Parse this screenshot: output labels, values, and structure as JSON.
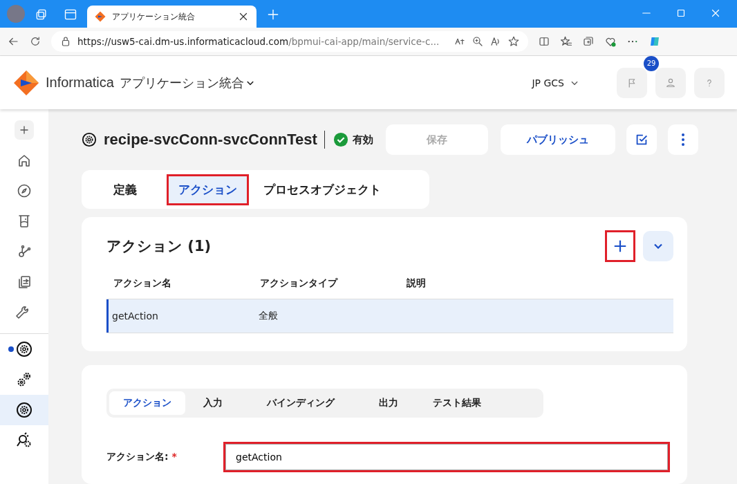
{
  "browser": {
    "tab_title": "アプリケーション統合",
    "url_host": "https://usw5-cai.dm-us.informaticacloud.com",
    "url_path": "/bpmui-cai-app/main/service-c..."
  },
  "app_header": {
    "brand": "Informatica",
    "product": "アプリケーション統合",
    "org": "JP GCS",
    "notification_count": "29"
  },
  "sidebar": {
    "items": [
      {
        "kind": "add",
        "selected": false,
        "marked": false
      },
      {
        "kind": "home",
        "selected": false,
        "marked": false
      },
      {
        "kind": "compass",
        "selected": false,
        "marked": false
      },
      {
        "kind": "beaker",
        "selected": false,
        "marked": false
      },
      {
        "kind": "network",
        "selected": false,
        "marked": false
      },
      {
        "kind": "transfer",
        "selected": false,
        "marked": false
      },
      {
        "kind": "wrench",
        "selected": false,
        "marked": false
      },
      {
        "kind": "gear",
        "selected": false,
        "marked": true
      },
      {
        "kind": "gears",
        "selected": false,
        "marked": false
      },
      {
        "kind": "gear",
        "selected": true,
        "marked": false
      },
      {
        "kind": "plug",
        "selected": false,
        "marked": false
      }
    ]
  },
  "page": {
    "title": "recipe-svcConn-svcConnTest",
    "status": "有効",
    "buttons": [
      {
        "label": "保存",
        "disabled": true
      },
      {
        "label": "パブリッシュ",
        "disabled": false
      }
    ]
  },
  "tabs": [
    {
      "label": "定義",
      "selected": false,
      "highlighted": false
    },
    {
      "label": "アクション",
      "selected": true,
      "highlighted": true
    },
    {
      "label": "プロセスオブジェクト",
      "selected": false,
      "highlighted": false
    }
  ],
  "actions_panel": {
    "title": "アクション (1)",
    "add_highlighted": true,
    "columns": [
      "アクション名",
      "アクションタイプ",
      "説明"
    ],
    "rows": [
      {
        "cells": [
          "getAction",
          "全般",
          ""
        ],
        "selected": true
      }
    ]
  },
  "detail_tabs": [
    {
      "label": "アクション",
      "selected": true
    },
    {
      "label": "入力",
      "selected": false
    },
    {
      "label": "バインディング",
      "selected": false
    },
    {
      "label": "出力",
      "selected": false
    },
    {
      "label": "テスト結果",
      "selected": false
    }
  ],
  "form": {
    "label": "アクション名:",
    "required_mark": "*",
    "value": "getAction",
    "highlighted": true
  }
}
